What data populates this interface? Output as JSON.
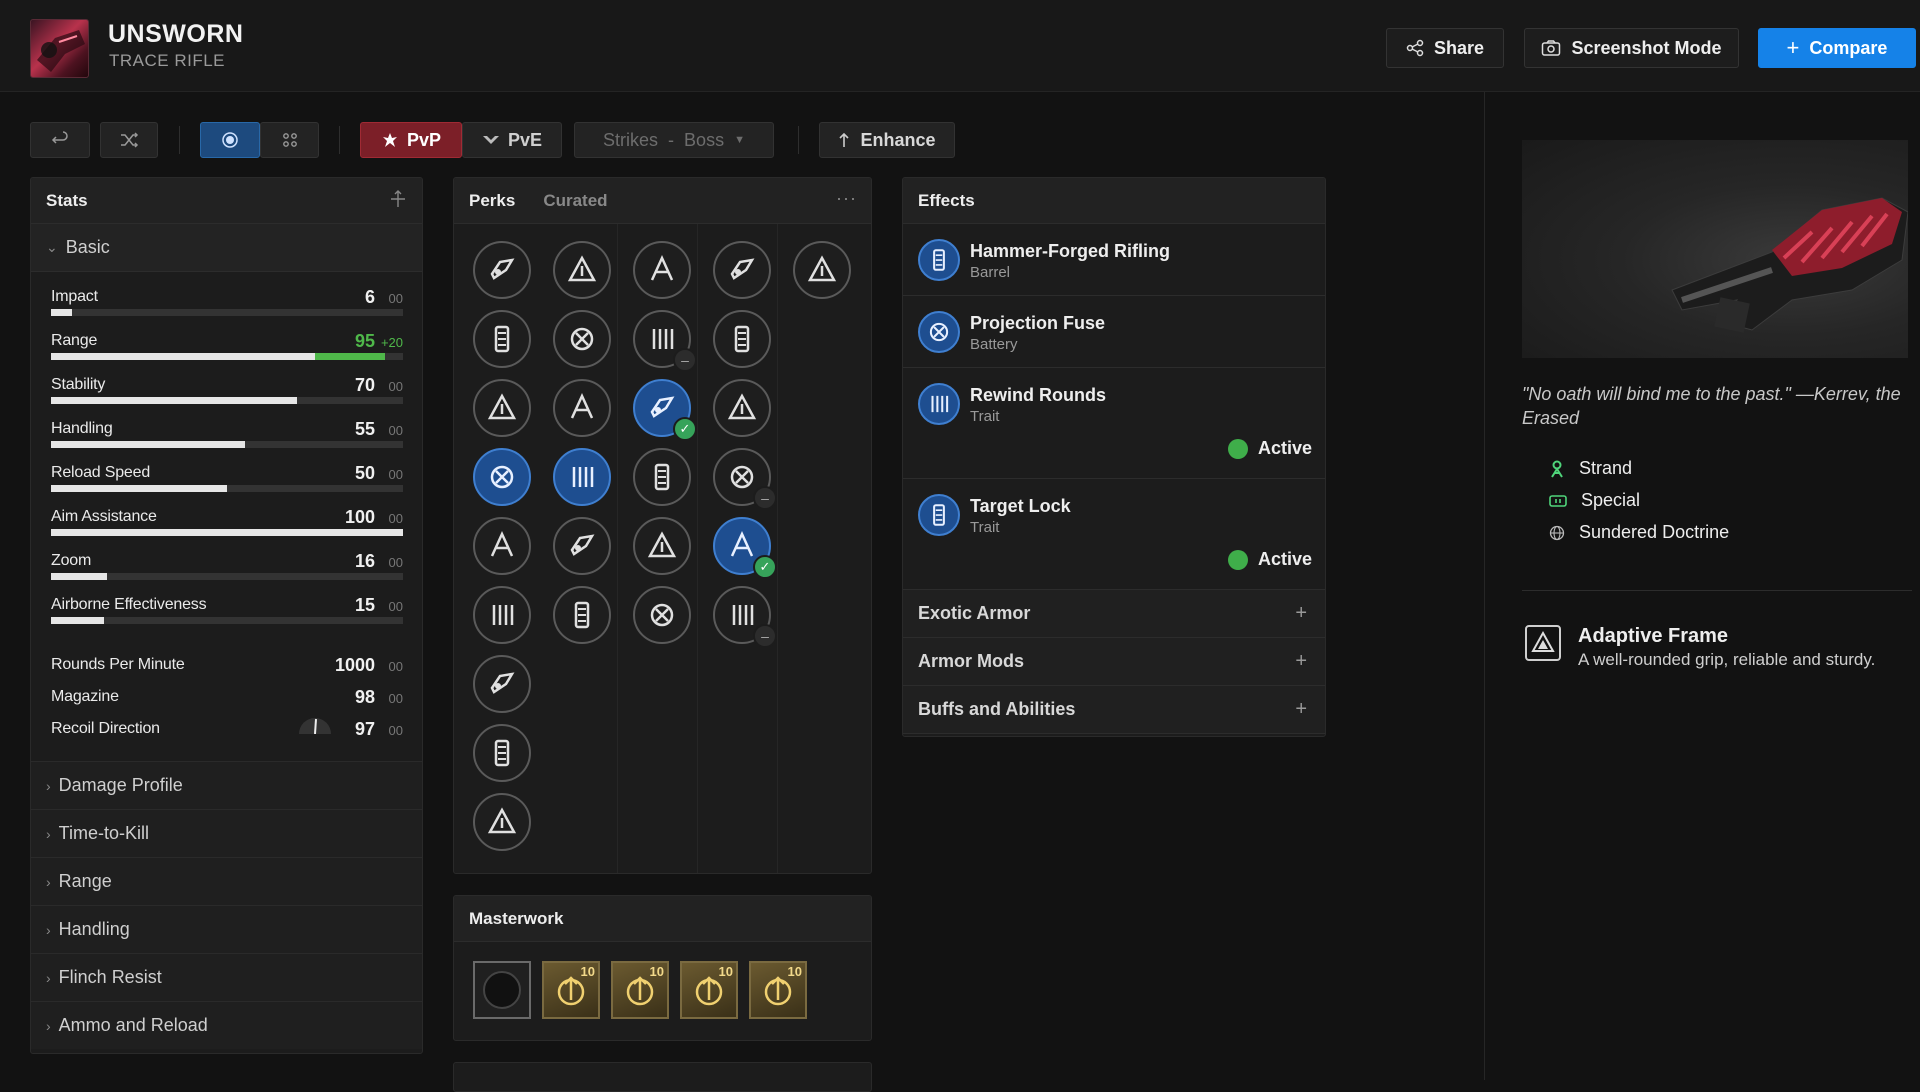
{
  "header": {
    "title": "UNSWORN",
    "subtitle": "TRACE RIFLE",
    "share_label": "Share",
    "screenshot_label": "Screenshot Mode",
    "compare_label": "Compare"
  },
  "toolbar": {
    "pvp_label": "PvP",
    "pve_label": "PvE",
    "activity_label": "Strikes",
    "activity_sep": "-",
    "difficulty_label": "Boss",
    "enhance_label": "Enhance",
    "mode_selected": "PvP",
    "view_selected": "single"
  },
  "stats": {
    "title": "Stats",
    "group_label": "Basic",
    "bar_stats": [
      {
        "label": "Impact",
        "value": "6",
        "mod": "00",
        "base": 6,
        "bonus": 0
      },
      {
        "label": "Range",
        "value": "95",
        "mod": "+20",
        "base": 75,
        "bonus": 20,
        "highlight": true
      },
      {
        "label": "Stability",
        "value": "70",
        "mod": "00",
        "base": 70,
        "bonus": 0
      },
      {
        "label": "Handling",
        "value": "55",
        "mod": "00",
        "base": 55,
        "bonus": 0
      },
      {
        "label": "Reload Speed",
        "value": "50",
        "mod": "00",
        "base": 50,
        "bonus": 0
      },
      {
        "label": "Aim Assistance",
        "value": "100",
        "mod": "00",
        "base": 100,
        "bonus": 0
      },
      {
        "label": "Zoom",
        "value": "16",
        "mod": "00",
        "base": 16,
        "bonus": 0
      },
      {
        "label": "Airborne Effectiveness",
        "value": "15",
        "mod": "00",
        "base": 15,
        "bonus": 0
      }
    ],
    "plain_stats": [
      {
        "label": "Rounds Per Minute",
        "value": "1000",
        "mod": "00"
      },
      {
        "label": "Magazine",
        "value": "98",
        "mod": "00"
      },
      {
        "label": "Recoil Direction",
        "value": "97",
        "mod": "00"
      }
    ],
    "sections": [
      "Damage Profile",
      "Time-to-Kill",
      "Range",
      "Handling",
      "Flinch Resist",
      "Ammo and Reload"
    ]
  },
  "perks": {
    "tab_active": "Perks",
    "tab_other": "Curated",
    "columns": [
      [
        "barrel-perk-1-icon",
        "barrel-perk-2-icon",
        "barrel-perk-3-icon",
        "barrel-perk-4-selected-icon",
        "barrel-perk-5-icon",
        "barrel-perk-6-icon",
        "barrel-perk-7-icon",
        "barrel-perk-8-icon",
        "barrel-perk-9-icon"
      ],
      [
        "battery-perk-1-icon",
        "battery-perk-2-icon",
        "battery-perk-3-icon",
        "battery-perk-4-selected-icon",
        "battery-perk-5-icon",
        "battery-perk-6-icon"
      ],
      [
        "trait1-perk-1-icon",
        "trait1-perk-2-icon",
        "trait1-perk-3-selected-icon",
        "trait1-perk-4-icon",
        "trait1-perk-5-icon",
        "trait1-perk-6-icon"
      ],
      [
        "trait2-perk-1-icon",
        "trait2-perk-2-icon",
        "trait2-perk-3-icon",
        "trait2-perk-4-icon",
        "trait2-perk-5-selected-icon",
        "trait2-perk-6-icon"
      ],
      [
        "origin-perk-1-icon"
      ]
    ]
  },
  "masterwork": {
    "title": "Masterwork",
    "items": [
      {
        "icon": "empty-masterwork-icon",
        "level": ""
      },
      {
        "icon": "masterwork-stat-1-icon",
        "level": "10"
      },
      {
        "icon": "masterwork-stat-2-icon",
        "level": "10"
      },
      {
        "icon": "masterwork-stat-3-icon",
        "level": "10"
      },
      {
        "icon": "masterwork-stat-4-icon",
        "level": "10"
      }
    ]
  },
  "effects": {
    "title": "Effects",
    "items": [
      {
        "name": "Hammer-Forged Rifling",
        "type": "Barrel",
        "status": ""
      },
      {
        "name": "Projection Fuse",
        "type": "Battery",
        "status": ""
      },
      {
        "name": "Rewind Rounds",
        "type": "Trait",
        "status": "Active"
      },
      {
        "name": "Target Lock",
        "type": "Trait",
        "status": "Active"
      }
    ],
    "accordions": [
      "Exotic Armor",
      "Armor Mods",
      "Buffs and Abilities"
    ]
  },
  "details": {
    "flavor": "\"No oath will bind me to the past.\" —Kerrev, the Erased",
    "element": "Strand",
    "ammo": "Special",
    "source": "Sundered Doctrine",
    "frame_name": "Adaptive Frame",
    "frame_desc": "A well-rounded grip, reliable and sturdy."
  },
  "colors": {
    "accent": "#1582e8",
    "pvp": "#7c1f28",
    "bonus_green": "#4fb84a",
    "active_green": "#3fae4a",
    "strand_green": "#4fd47a",
    "perk_selected": "#1e4e90"
  }
}
